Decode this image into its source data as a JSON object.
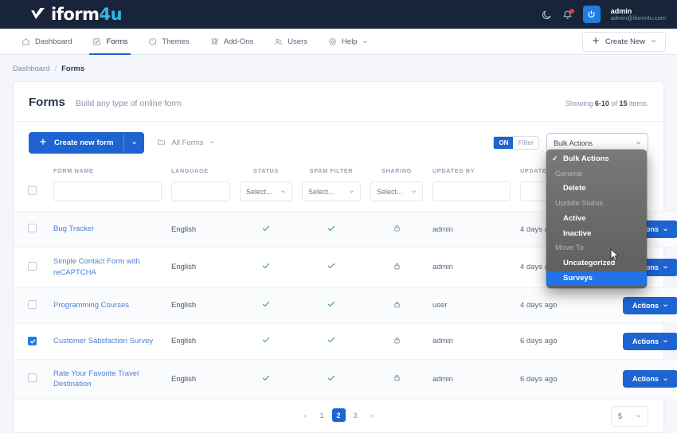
{
  "topbar": {
    "brand": "iform",
    "brand_accent": "4u",
    "moon_icon": "moon-icon",
    "bell_icon": "bell-icon",
    "avatar_icon": "power-avatar-icon",
    "user_name": "admin",
    "user_email": "admin@iform4u.com",
    "accent": "#2fb8e6"
  },
  "nav": {
    "items": [
      {
        "label": "Dashboard",
        "icon": "home-icon",
        "active": false
      },
      {
        "label": "Forms",
        "icon": "checklist-icon",
        "active": true
      },
      {
        "label": "Themes",
        "icon": "palette-icon",
        "active": false
      },
      {
        "label": "Add-Ons",
        "icon": "puzzle-icon",
        "active": false
      },
      {
        "label": "Users",
        "icon": "users-icon",
        "active": false
      },
      {
        "label": "Help",
        "icon": "lifebuoy-icon",
        "active": false,
        "caret": true
      }
    ],
    "create_new": "Create New"
  },
  "breadcrumb": {
    "root": "Dashboard",
    "separator": "/",
    "current": "Forms"
  },
  "card": {
    "title": "Forms",
    "subtitle": "Build any type of online form",
    "showing_prefix": "Showing",
    "showing_range": "6-10",
    "showing_mid": "of",
    "showing_total": "15",
    "showing_suffix": "items."
  },
  "toolbar": {
    "create_new_form": "Create new form",
    "all_forms": "All Forms",
    "folder_icon": "folder-icon",
    "toggle_on": "ON",
    "toggle_off": "Filter",
    "bulk_select_value": "Bulk Actions",
    "primary_color": "#1e64d0"
  },
  "table": {
    "headers": {
      "form_name": "FORM NAME",
      "language": "LANGUAGE",
      "status": "STATUS",
      "spam_filter": "SPAM FILTER",
      "sharing": "SHARING",
      "updated_by": "UPDATED BY",
      "updated": "UPDATED"
    },
    "filters": {
      "form_name_value": "",
      "language_value": "",
      "status_select": "Select...",
      "spam_select": "Select...",
      "sharing_select": "Select...",
      "updated_by_value": "",
      "updated_value": ""
    },
    "rows": [
      {
        "checked": false,
        "name": "Bug Tracker",
        "language": "English",
        "status": "check-icon",
        "spam": "check-icon",
        "sharing": "lock-icon",
        "updated_by": "admin",
        "updated": "4 days ago",
        "action": "Actions"
      },
      {
        "checked": false,
        "name": "Simple Contact Form with reCAPTCHA",
        "language": "English",
        "status": "check-icon",
        "spam": "check-icon",
        "sharing": "lock-icon",
        "updated_by": "admin",
        "updated": "4 days ago",
        "action": "Actions"
      },
      {
        "checked": false,
        "name": "Programming Courses",
        "language": "English",
        "status": "check-icon",
        "spam": "check-icon",
        "sharing": "lock-icon",
        "updated_by": "user",
        "updated": "4 days ago",
        "action": "Actions"
      },
      {
        "checked": true,
        "name": "Customer Satisfaction Survey",
        "language": "English",
        "status": "check-icon",
        "spam": "check-icon",
        "sharing": "lock-icon",
        "updated_by": "admin",
        "updated": "6 days ago",
        "action": "Actions"
      },
      {
        "checked": false,
        "name": "Rate Your Favorite Travel Destination",
        "language": "English",
        "status": "check-icon",
        "spam": "check-icon",
        "sharing": "lock-icon",
        "updated_by": "admin",
        "updated": "6 days ago",
        "action": "Actions"
      }
    ]
  },
  "pagination": {
    "prev": "«",
    "pages": [
      "1",
      "2",
      "3"
    ],
    "active_page": "2",
    "next": "»",
    "page_size": "5"
  },
  "bulk_popup": {
    "options": [
      {
        "label": "Bulk Actions",
        "type": "item",
        "checked": true,
        "selected": false
      },
      {
        "label": "General",
        "type": "group",
        "checked": false,
        "selected": false
      },
      {
        "label": "Delete",
        "type": "item",
        "checked": false,
        "selected": false
      },
      {
        "label": "Update Status",
        "type": "group",
        "checked": false,
        "selected": false
      },
      {
        "label": "Active",
        "type": "item",
        "checked": false,
        "selected": false
      },
      {
        "label": "Inactive",
        "type": "item",
        "checked": false,
        "selected": false
      },
      {
        "label": "Move To",
        "type": "group",
        "checked": false,
        "selected": false
      },
      {
        "label": "Uncategorized",
        "type": "item",
        "checked": false,
        "selected": false
      },
      {
        "label": "Surveys",
        "type": "item",
        "checked": false,
        "selected": true
      }
    ],
    "highlight_color": "#2272e8"
  }
}
